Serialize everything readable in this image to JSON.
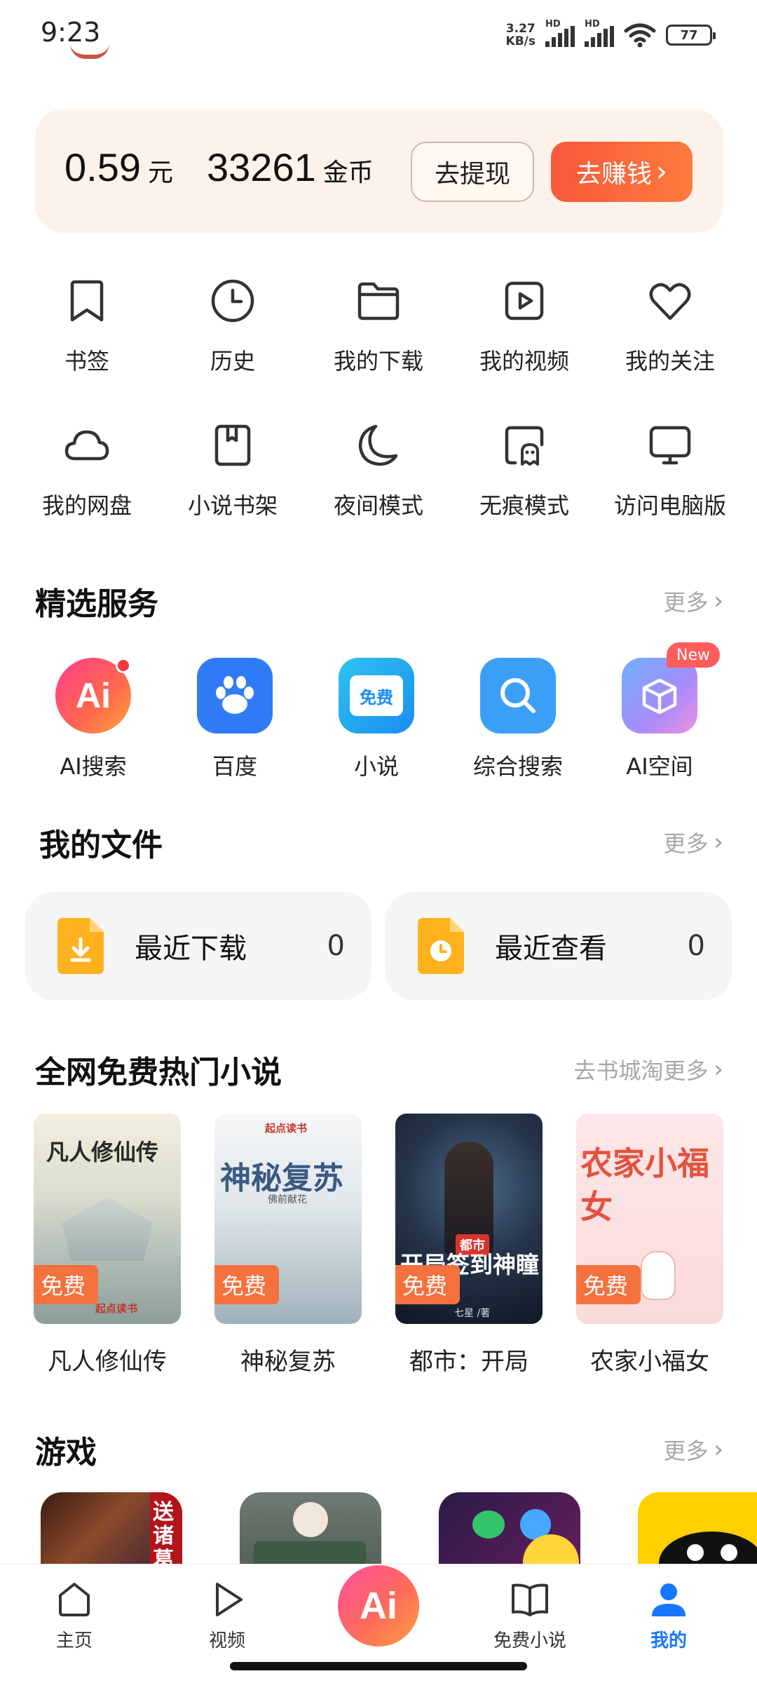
{
  "status_bar": {
    "time": "9:23",
    "net_speed_value": "3.27",
    "net_speed_unit": "KB/s",
    "hd1": "HD",
    "hd2": "HD",
    "battery": "77",
    "icons": [
      "signal-icon",
      "signal-icon",
      "wifi-icon",
      "battery-icon"
    ]
  },
  "wallet": {
    "cash_value": "0.59",
    "cash_unit": "元",
    "coins_value": "33261",
    "coins_unit": "金币",
    "withdraw_label": "去提现",
    "earn_label": "去赚钱",
    "earn_chevron": "›"
  },
  "quick_actions": [
    {
      "label": "书签",
      "icon": "bookmark-icon"
    },
    {
      "label": "历史",
      "icon": "clock-icon"
    },
    {
      "label": "我的下载",
      "icon": "folder-icon"
    },
    {
      "label": "我的视频",
      "icon": "video-icon"
    },
    {
      "label": "我的关注",
      "icon": "heart-icon"
    },
    {
      "label": "我的网盘",
      "icon": "cloud-icon"
    },
    {
      "label": "小说书架",
      "icon": "book-icon"
    },
    {
      "label": "夜间模式",
      "icon": "moon-icon"
    },
    {
      "label": "无痕模式",
      "icon": "ghost-icon"
    },
    {
      "label": "访问电脑版",
      "icon": "monitor-icon"
    }
  ],
  "featured": {
    "title": "精选服务",
    "more": "更多",
    "chevron": "›",
    "items": [
      {
        "label": "AI搜索",
        "icon": "ai-search-icon",
        "text": "Ai"
      },
      {
        "label": "百度",
        "icon": "baidu-paw-icon"
      },
      {
        "label": "小说",
        "icon": "novel-book-icon",
        "text": "免费"
      },
      {
        "label": "综合搜索",
        "icon": "search-icon"
      },
      {
        "label": "AI空间",
        "icon": "ai-space-cube-icon",
        "badge": "New"
      }
    ]
  },
  "files": {
    "title": "我的文件",
    "more": "更多",
    "chevron": "›",
    "recent_download": {
      "label": "最近下载",
      "count": "0"
    },
    "recent_view": {
      "label": "最近查看",
      "count": "0"
    }
  },
  "novels": {
    "title": "全网免费热门小说",
    "more": "去书城淘更多",
    "chevron": "›",
    "free_tag": "免费",
    "items": [
      {
        "label": "凡人修仙传",
        "cover_title": "凡人修仙传",
        "cover_brand": "起点读书"
      },
      {
        "label": "神秘复苏",
        "cover_title": "神秘复苏",
        "cover_brand": "起点读书",
        "cover_author": "佛前献花"
      },
      {
        "label": "都市：开局",
        "cover_title": "开局签到神瞳",
        "cover_tag": "都市",
        "cover_author": "七星 /著"
      },
      {
        "label": "农家小福女",
        "cover_title": "农家小福女"
      }
    ]
  },
  "games": {
    "title": "游戏",
    "more": "更多",
    "chevron": "›",
    "first_banner_text": "送诸葛"
  },
  "bottom_nav": [
    {
      "label": "主页",
      "icon": "home-icon"
    },
    {
      "label": "视频",
      "icon": "play-icon"
    },
    {
      "label": "Ai",
      "icon": "ai-center-icon"
    },
    {
      "label": "免费小说",
      "icon": "open-book-icon"
    },
    {
      "label": "我的",
      "icon": "profile-icon",
      "active": true
    }
  ],
  "colors": {
    "accent": "#f7593a",
    "active_nav": "#1677ff",
    "wallet_bg": "#fdf2ea"
  }
}
